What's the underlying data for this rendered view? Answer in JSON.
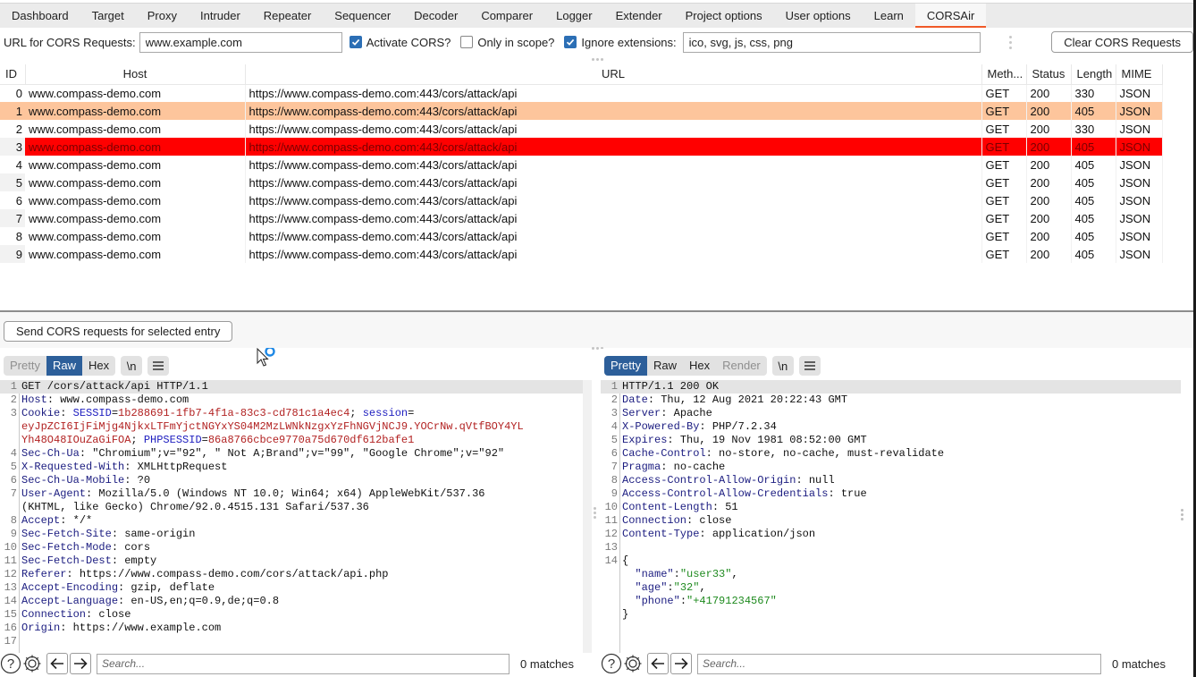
{
  "tabs": [
    {
      "label": "Dashboard",
      "active": false
    },
    {
      "label": "Target",
      "active": false
    },
    {
      "label": "Proxy",
      "active": false
    },
    {
      "label": "Intruder",
      "active": false
    },
    {
      "label": "Repeater",
      "active": false
    },
    {
      "label": "Sequencer",
      "active": false
    },
    {
      "label": "Decoder",
      "active": false
    },
    {
      "label": "Comparer",
      "active": false
    },
    {
      "label": "Logger",
      "active": false
    },
    {
      "label": "Extender",
      "active": false
    },
    {
      "label": "Project options",
      "active": false
    },
    {
      "label": "User options",
      "active": false
    },
    {
      "label": "Learn",
      "active": false
    },
    {
      "label": "CORSAir",
      "active": true
    }
  ],
  "accent_color": "#f05a28",
  "options": {
    "url_label": "URL for CORS Requests:",
    "url_value": "www.example.com",
    "activate_cors_label": "Activate CORS?",
    "activate_cors_checked": true,
    "only_in_scope_label": "Only in scope?",
    "only_in_scope_checked": false,
    "ignore_ext_label": "Ignore extensions:",
    "ignore_ext_checked": true,
    "ignore_ext_value": "ico, svg, js, css, png",
    "clear_button": "Clear CORS Requests"
  },
  "table": {
    "columns": [
      "ID",
      "Host",
      "URL",
      "Meth...",
      "Status",
      "Length",
      "MIME"
    ],
    "rows": [
      {
        "id": "0",
        "host": "www.compass-demo.com",
        "url": "https://www.compass-demo.com:443/cors/attack/api",
        "method": "GET",
        "status": "200",
        "length": "330",
        "mime": "JSON",
        "highlight": "none"
      },
      {
        "id": "1",
        "host": "www.compass-demo.com",
        "url": "https://www.compass-demo.com:443/cors/attack/api",
        "method": "GET",
        "status": "200",
        "length": "405",
        "mime": "JSON",
        "highlight": "selected"
      },
      {
        "id": "2",
        "host": "www.compass-demo.com",
        "url": "https://www.compass-demo.com:443/cors/attack/api",
        "method": "GET",
        "status": "200",
        "length": "330",
        "mime": "JSON",
        "highlight": "none"
      },
      {
        "id": "3",
        "host": "www.compass-demo.com",
        "url": "https://www.compass-demo.com:443/cors/attack/api",
        "method": "GET",
        "status": "200",
        "length": "405",
        "mime": "JSON",
        "highlight": "red"
      },
      {
        "id": "4",
        "host": "www.compass-demo.com",
        "url": "https://www.compass-demo.com:443/cors/attack/api",
        "method": "GET",
        "status": "200",
        "length": "405",
        "mime": "JSON",
        "highlight": "none"
      },
      {
        "id": "5",
        "host": "www.compass-demo.com",
        "url": "https://www.compass-demo.com:443/cors/attack/api",
        "method": "GET",
        "status": "200",
        "length": "405",
        "mime": "JSON",
        "highlight": "none"
      },
      {
        "id": "6",
        "host": "www.compass-demo.com",
        "url": "https://www.compass-demo.com:443/cors/attack/api",
        "method": "GET",
        "status": "200",
        "length": "405",
        "mime": "JSON",
        "highlight": "none"
      },
      {
        "id": "7",
        "host": "www.compass-demo.com",
        "url": "https://www.compass-demo.com:443/cors/attack/api",
        "method": "GET",
        "status": "200",
        "length": "405",
        "mime": "JSON",
        "highlight": "none"
      },
      {
        "id": "8",
        "host": "www.compass-demo.com",
        "url": "https://www.compass-demo.com:443/cors/attack/api",
        "method": "GET",
        "status": "200",
        "length": "405",
        "mime": "JSON",
        "highlight": "none"
      },
      {
        "id": "9",
        "host": "www.compass-demo.com",
        "url": "https://www.compass-demo.com:443/cors/attack/api",
        "method": "GET",
        "status": "200",
        "length": "405",
        "mime": "JSON",
        "highlight": "none"
      }
    ],
    "highlight_colors": {
      "selected": "#fdc59c",
      "red": "#ff0000"
    }
  },
  "send_button": "Send CORS requests for selected entry",
  "request": {
    "view_tabs": [
      {
        "label": "Pretty",
        "state": "disabled"
      },
      {
        "label": "Raw",
        "state": "active"
      },
      {
        "label": "Hex",
        "state": "normal"
      }
    ],
    "newline_button": "\\n",
    "menu_icon": "hamburger-menu-icon",
    "lines": [
      {
        "n": "1",
        "parts": [
          {
            "c": "",
            "t": "GET /cors/attack/api HTTP/1.1"
          }
        ]
      },
      {
        "n": "2",
        "parts": [
          {
            "c": "k",
            "t": "Host"
          },
          {
            "c": "",
            "t": ": www.compass-demo.com"
          }
        ]
      },
      {
        "n": "3",
        "parts": [
          {
            "c": "k",
            "t": "Cookie"
          },
          {
            "c": "",
            "t": ": "
          },
          {
            "c": "rk",
            "t": "SESSID"
          },
          {
            "c": "",
            "t": "="
          },
          {
            "c": "rv",
            "t": "1b288691-1fb7-4f1a-83c3-cd781c1a4ec4"
          },
          {
            "c": "",
            "t": "; "
          },
          {
            "c": "rk",
            "t": "session"
          },
          {
            "c": "",
            "t": "="
          }
        ]
      },
      {
        "n": "",
        "parts": [
          {
            "c": "rv",
            "t": "eyJpZCI6IjFiMjg4NjkxLTFmYjctNGYxYS04M2MzLWNkNzgxYzFhNGVjNCJ9.YOCrNw.qVtfBOY4YL"
          }
        ]
      },
      {
        "n": "",
        "parts": [
          {
            "c": "rv",
            "t": "Yh48O48IOuZaGiFOA"
          },
          {
            "c": "",
            "t": "; "
          },
          {
            "c": "rk",
            "t": "PHPSESSID"
          },
          {
            "c": "",
            "t": "="
          },
          {
            "c": "rv",
            "t": "86a8766cbce9770a75d670df612bafe1"
          }
        ]
      },
      {
        "n": "4",
        "parts": [
          {
            "c": "k",
            "t": "Sec-Ch-Ua"
          },
          {
            "c": "",
            "t": ": \"Chromium\";v=\"92\", \" Not A;Brand\";v=\"99\", \"Google Chrome\";v=\"92\""
          }
        ]
      },
      {
        "n": "5",
        "parts": [
          {
            "c": "k",
            "t": "X-Requested-With"
          },
          {
            "c": "",
            "t": ": XMLHttpRequest"
          }
        ]
      },
      {
        "n": "6",
        "parts": [
          {
            "c": "k",
            "t": "Sec-Ch-Ua-Mobile"
          },
          {
            "c": "",
            "t": ": ?0"
          }
        ]
      },
      {
        "n": "7",
        "parts": [
          {
            "c": "k",
            "t": "User-Agent"
          },
          {
            "c": "",
            "t": ": Mozilla/5.0 (Windows NT 10.0; Win64; x64) AppleWebKit/537.36"
          }
        ]
      },
      {
        "n": "",
        "parts": [
          {
            "c": "",
            "t": "(KHTML, like Gecko) Chrome/92.0.4515.131 Safari/537.36"
          }
        ]
      },
      {
        "n": "8",
        "parts": [
          {
            "c": "k",
            "t": "Accept"
          },
          {
            "c": "",
            "t": ": */*"
          }
        ]
      },
      {
        "n": "9",
        "parts": [
          {
            "c": "k",
            "t": "Sec-Fetch-Site"
          },
          {
            "c": "",
            "t": ": same-origin"
          }
        ]
      },
      {
        "n": "10",
        "parts": [
          {
            "c": "k",
            "t": "Sec-Fetch-Mode"
          },
          {
            "c": "",
            "t": ": cors"
          }
        ]
      },
      {
        "n": "11",
        "parts": [
          {
            "c": "k",
            "t": "Sec-Fetch-Dest"
          },
          {
            "c": "",
            "t": ": empty"
          }
        ]
      },
      {
        "n": "12",
        "parts": [
          {
            "c": "k",
            "t": "Referer"
          },
          {
            "c": "",
            "t": ": https://www.compass-demo.com/cors/attack/api.php"
          }
        ]
      },
      {
        "n": "13",
        "parts": [
          {
            "c": "k",
            "t": "Accept-Encoding"
          },
          {
            "c": "",
            "t": ": gzip, deflate"
          }
        ]
      },
      {
        "n": "14",
        "parts": [
          {
            "c": "k",
            "t": "Accept-Language"
          },
          {
            "c": "",
            "t": ": en-US,en;q=0.9,de;q=0.8"
          }
        ]
      },
      {
        "n": "15",
        "parts": [
          {
            "c": "k",
            "t": "Connection"
          },
          {
            "c": "",
            "t": ": close"
          }
        ]
      },
      {
        "n": "16",
        "parts": [
          {
            "c": "k",
            "t": "Origin"
          },
          {
            "c": "",
            "t": ": https://www.example.com"
          }
        ]
      },
      {
        "n": "17",
        "parts": [
          {
            "c": "",
            "t": ""
          }
        ]
      }
    ],
    "search_placeholder": "Search...",
    "matches": "0 matches"
  },
  "response": {
    "view_tabs": [
      {
        "label": "Pretty",
        "state": "active"
      },
      {
        "label": "Raw",
        "state": "normal"
      },
      {
        "label": "Hex",
        "state": "normal"
      },
      {
        "label": "Render",
        "state": "disabled"
      }
    ],
    "newline_button": "\\n",
    "menu_icon": "hamburger-menu-icon",
    "lines": [
      {
        "n": "1",
        "parts": [
          {
            "c": "",
            "t": "HTTP/1.1 200 OK"
          }
        ]
      },
      {
        "n": "2",
        "parts": [
          {
            "c": "k",
            "t": "Date"
          },
          {
            "c": "",
            "t": ": Thu, 12 Aug 2021 20:22:43 GMT"
          }
        ]
      },
      {
        "n": "3",
        "parts": [
          {
            "c": "k",
            "t": "Server"
          },
          {
            "c": "",
            "t": ": Apache"
          }
        ]
      },
      {
        "n": "4",
        "parts": [
          {
            "c": "k",
            "t": "X-Powered-By"
          },
          {
            "c": "",
            "t": ": PHP/7.2.34"
          }
        ]
      },
      {
        "n": "5",
        "parts": [
          {
            "c": "k",
            "t": "Expires"
          },
          {
            "c": "",
            "t": ": Thu, 19 Nov 1981 08:52:00 GMT"
          }
        ]
      },
      {
        "n": "6",
        "parts": [
          {
            "c": "k",
            "t": "Cache-Control"
          },
          {
            "c": "",
            "t": ": no-store, no-cache, must-revalidate"
          }
        ]
      },
      {
        "n": "7",
        "parts": [
          {
            "c": "k",
            "t": "Pragma"
          },
          {
            "c": "",
            "t": ": no-cache"
          }
        ]
      },
      {
        "n": "8",
        "parts": [
          {
            "c": "k",
            "t": "Access-Control-Allow-Origin"
          },
          {
            "c": "",
            "t": ": null"
          }
        ]
      },
      {
        "n": "9",
        "parts": [
          {
            "c": "k",
            "t": "Access-Control-Allow-Credentials"
          },
          {
            "c": "",
            "t": ": true"
          }
        ]
      },
      {
        "n": "10",
        "parts": [
          {
            "c": "k",
            "t": "Content-Length"
          },
          {
            "c": "",
            "t": ": 51"
          }
        ]
      },
      {
        "n": "11",
        "parts": [
          {
            "c": "k",
            "t": "Connection"
          },
          {
            "c": "",
            "t": ": close"
          }
        ]
      },
      {
        "n": "12",
        "parts": [
          {
            "c": "k",
            "t": "Content-Type"
          },
          {
            "c": "",
            "t": ": application/json"
          }
        ]
      },
      {
        "n": "13",
        "parts": [
          {
            "c": "",
            "t": ""
          }
        ]
      },
      {
        "n": "14",
        "parts": [
          {
            "c": "",
            "t": "{"
          }
        ]
      },
      {
        "n": "",
        "parts": [
          {
            "c": "",
            "t": "  "
          },
          {
            "c": "js",
            "t": "\"name\""
          },
          {
            "c": "",
            "t": ":"
          },
          {
            "c": "jv",
            "t": "\"user33\""
          },
          {
            "c": "",
            "t": ","
          }
        ]
      },
      {
        "n": "",
        "parts": [
          {
            "c": "",
            "t": "  "
          },
          {
            "c": "js",
            "t": "\"age\""
          },
          {
            "c": "",
            "t": ":"
          },
          {
            "c": "jv",
            "t": "\"32\""
          },
          {
            "c": "",
            "t": ","
          }
        ]
      },
      {
        "n": "",
        "parts": [
          {
            "c": "",
            "t": "  "
          },
          {
            "c": "js",
            "t": "\"phone\""
          },
          {
            "c": "",
            "t": ":"
          },
          {
            "c": "jv",
            "t": "\"+41791234567\""
          }
        ]
      },
      {
        "n": "",
        "parts": [
          {
            "c": "",
            "t": "}"
          }
        ]
      }
    ],
    "search_placeholder": "Search...",
    "matches": "0 matches"
  }
}
